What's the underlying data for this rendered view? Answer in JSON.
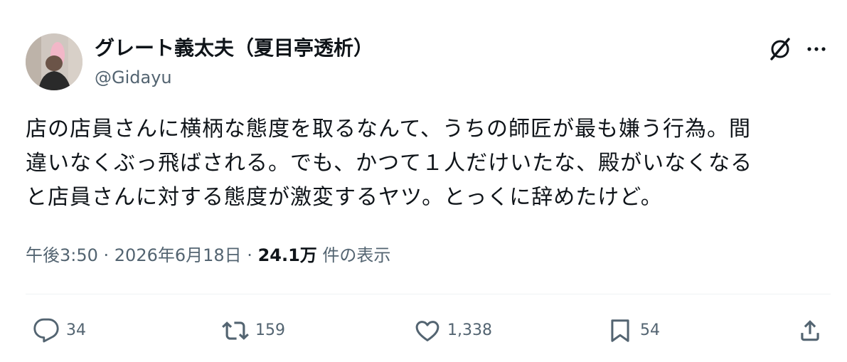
{
  "author": {
    "display_name": "グレート義太夫（夏目亭透析）",
    "handle": "@Gidayu"
  },
  "tweet": {
    "lines": [
      "店の店員さんに横柄な態度を取るなんて、うちの師匠が最も嫌う行為。間",
      "違いなくぶっ飛ばされる。でも、かつて１人だけいたな、殿がいなくなる",
      "と店員さんに対する態度が激変するヤツ。とっくに辞めたけど。"
    ]
  },
  "meta": {
    "timestamp": "午後3:50 · 2026年6月18日 · ",
    "views_count": "24.1万",
    "views_label": " 件の表示"
  },
  "actions": {
    "replies": "34",
    "retweets": "159",
    "likes": "1,338",
    "bookmarks": "54"
  },
  "icons": {
    "grok": "grok-icon",
    "more": "more-icon",
    "reply": "reply-icon",
    "retweet": "retweet-icon",
    "like": "heart-icon",
    "bookmark": "bookmark-icon",
    "share": "share-icon"
  },
  "colors": {
    "text": "#0f1419",
    "secondary": "#536471",
    "divider": "#eff3f4"
  }
}
